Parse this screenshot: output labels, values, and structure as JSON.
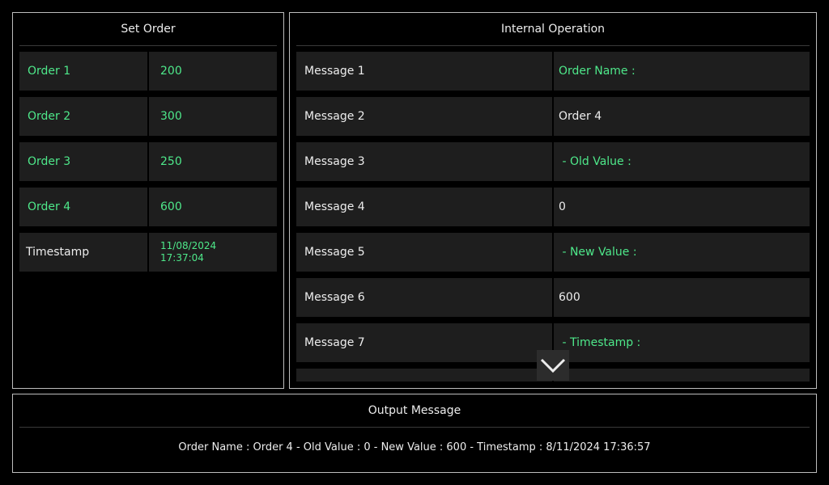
{
  "set_order": {
    "title": "Set Order",
    "orders": [
      {
        "label": "Order 1",
        "value": "200"
      },
      {
        "label": "Order 2",
        "value": "300"
      },
      {
        "label": "Order 3",
        "value": "250"
      },
      {
        "label": "Order 4",
        "value": "600"
      }
    ],
    "timestamp": {
      "label": "Timestamp",
      "date": "11/08/2024",
      "time": "17:37:04"
    }
  },
  "internal_operation": {
    "title": "Internal Operation",
    "messages": [
      {
        "label": "Message 1",
        "value": "Order Name :"
      },
      {
        "label": "Message 2",
        "value": "Order 4"
      },
      {
        "label": "Message 3",
        "value": " - Old Value :"
      },
      {
        "label": "Message 4",
        "value": "0"
      },
      {
        "label": "Message 5",
        "value": " - New Value :"
      },
      {
        "label": "Message 6",
        "value": "600"
      },
      {
        "label": "Message 7",
        "value": " - Timestamp :"
      }
    ],
    "scroll_icon": "chevron-down-icon"
  },
  "output_message": {
    "title": "Output Message",
    "text": "Order Name : Order 4 - Old Value : 0 - New Value : 600 - Timestamp : 8/11/2024  17:36:57"
  },
  "colors": {
    "background": "#000000",
    "cell": "#1e1e1e",
    "accent_green": "#4ee88a",
    "text": "#ededed",
    "border": "#bdbdbd"
  }
}
